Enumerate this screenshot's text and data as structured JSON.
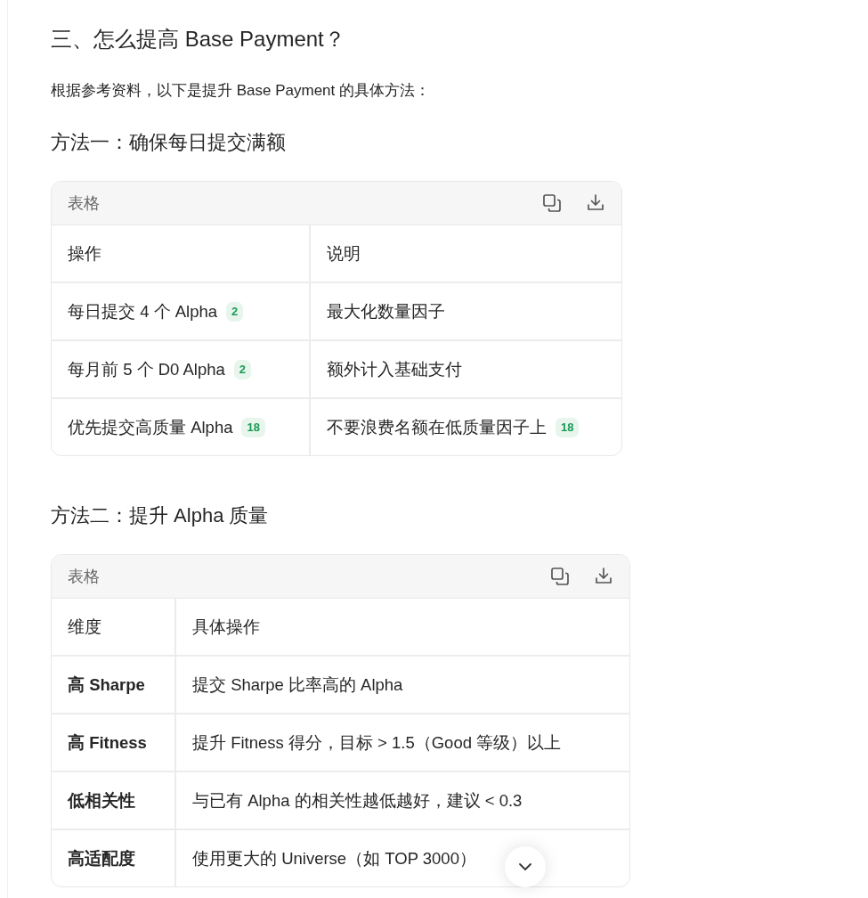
{
  "heading": "三、怎么提高 Base Payment？",
  "intro": "根据参考资料，以下是提升 Base Payment 的具体方法：",
  "sections": [
    {
      "title": "方法一：确保每日提交满额",
      "table": {
        "label": "表格",
        "first_column_bold": false,
        "columns": [
          "操作",
          "说明"
        ],
        "rows": [
          [
            {
              "text": "每日提交 4 个 Alpha",
              "badge": "2"
            },
            {
              "text": "最大化数量因子"
            }
          ],
          [
            {
              "text": "每月前 5 个 D0 Alpha",
              "badge": "2"
            },
            {
              "text": "额外计入基础支付"
            }
          ],
          [
            {
              "text": "优先提交高质量 Alpha",
              "badge": "18"
            },
            {
              "text": "不要浪费名额在低质量因子上",
              "badge": "18"
            }
          ]
        ]
      }
    },
    {
      "title": "方法二：提升 Alpha 质量",
      "table": {
        "label": "表格",
        "first_column_bold": true,
        "columns": [
          "维度",
          "具体操作"
        ],
        "rows": [
          [
            {
              "text": "高 Sharpe"
            },
            {
              "text": "提交 Sharpe 比率高的 Alpha"
            }
          ],
          [
            {
              "text": "高 Fitness"
            },
            {
              "text": "提升 Fitness 得分，目标 > 1.5（Good 等级）以上"
            }
          ],
          [
            {
              "text": "低相关性"
            },
            {
              "text": "与已有 Alpha 的相关性越低越好，建议 < 0.3"
            }
          ],
          [
            {
              "text": "高适配度"
            },
            {
              "text": "使用更大的 Universe（如 TOP 3000）"
            }
          ]
        ]
      }
    }
  ]
}
